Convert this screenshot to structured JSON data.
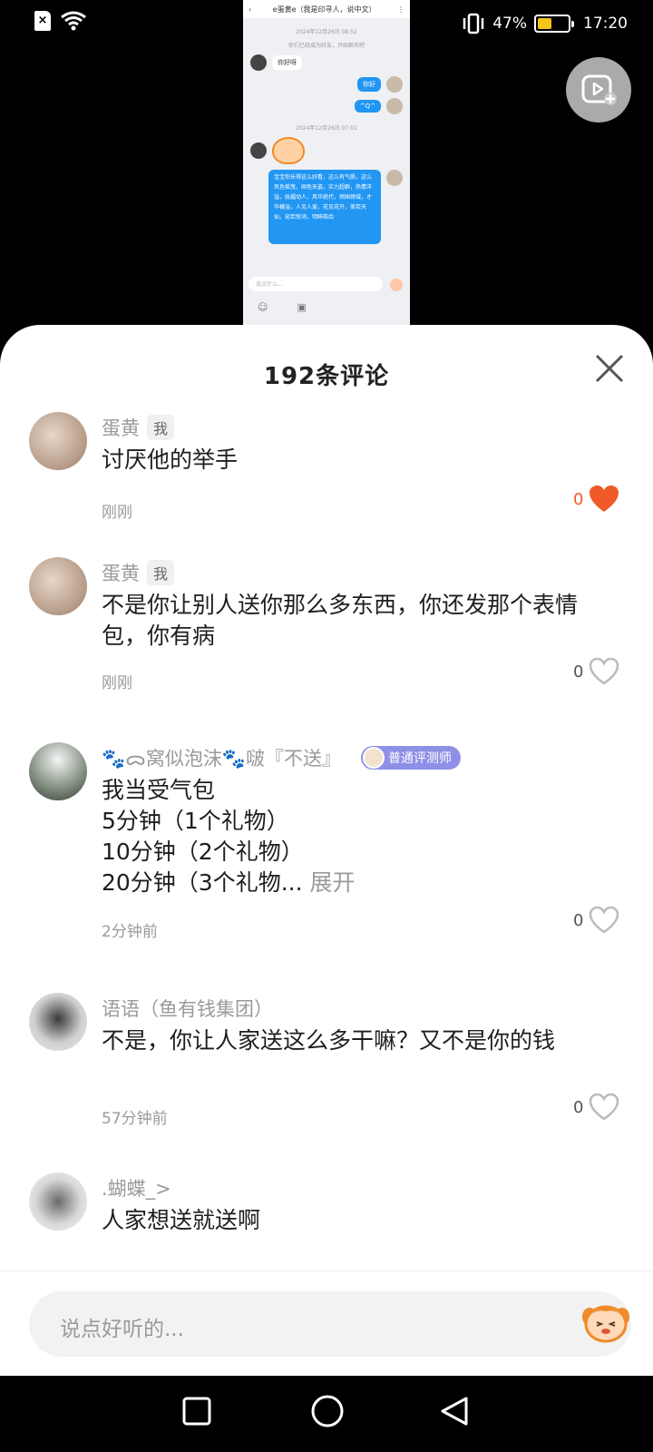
{
  "status_bar": {
    "battery_percent": "47%",
    "time": "17:20",
    "battery_level": 0.47,
    "battery_color": "#f5c518"
  },
  "video": {
    "chat_title": "e蛋黄e（我是印寻人，说中文）",
    "timestamp_1": "2024年12月26日 08:52",
    "system_notice": "你们已经成为好友，开始聊天吧",
    "msg_1": "你好呀",
    "msg_2": "你好",
    "msg_3": "^Q^",
    "timestamp_2": "2024年12月26日 07:01",
    "long_msg": "宝宝你长得这么好看，这么有气质，这么风色摇曳，国色天姿，实力超群，热情洋溢，妩媚动人，风华绝代，倾国倾城，才华横溢，人见人爱，花见花开，美若天仙，宛若惊鸿，明眸皓齿",
    "input_placeholder": "说点什么..."
  },
  "sheet": {
    "title": "192条评论",
    "close_icon": "close-icon"
  },
  "comments": [
    {
      "name": "蛋黄",
      "badge": "我",
      "text": "讨厌他的举手",
      "time": "刚刚",
      "likes": "0",
      "liked": true
    },
    {
      "name": "蛋黄",
      "badge": "我",
      "text": "不是你让别人送你那么多东西，你还发那个表情包，你有病",
      "time": "刚刚",
      "likes": "0",
      "liked": false
    },
    {
      "name": "🐾ᯅ窝似泡沫🐾啵『不送』",
      "role_badge": "普通评测师",
      "text_lines": [
        "我当受气包",
        "5分钟（1个礼物）",
        "10分钟（2个礼物）"
      ],
      "text_last": "20分钟（3个礼物...",
      "expand": "展开",
      "time": "2分钟前",
      "likes": "0",
      "liked": false
    },
    {
      "name": "语语（鱼有钱集团）",
      "text": "不是，你让人家送这么多干嘛？又不是你的钱",
      "time": "57分钟前",
      "likes": "0",
      "liked": false
    },
    {
      "name": ".蝴蝶_>",
      "text": "人家想送就送啊"
    }
  ],
  "input": {
    "placeholder": "说点好听的..."
  },
  "colors": {
    "like_active": "#f05a28",
    "role_badge": "#8e8fe6"
  }
}
